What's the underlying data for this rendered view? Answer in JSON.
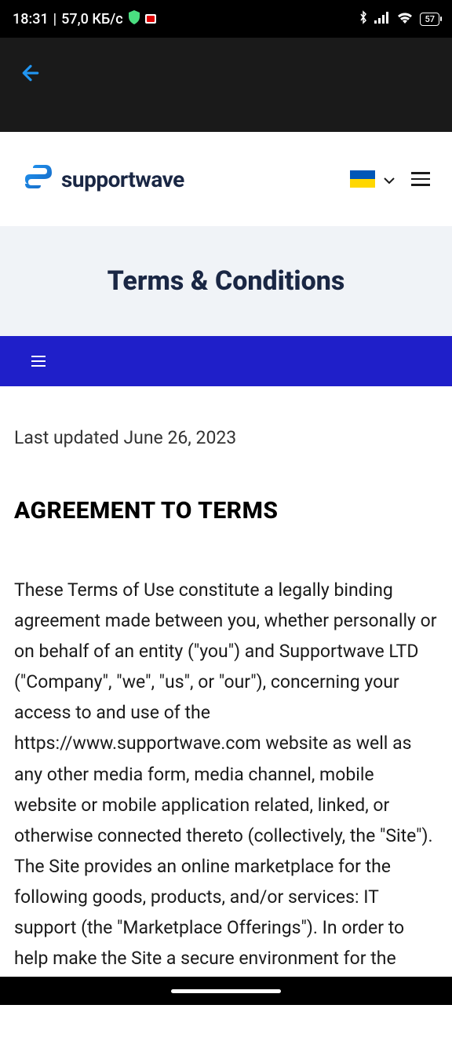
{
  "statusBar": {
    "time": "18:31",
    "dataRate": "57,0 КБ/с",
    "batteryLevel": "57"
  },
  "header": {
    "brandName": "supportwave"
  },
  "page": {
    "title": "Terms & Conditions",
    "lastUpdated": "Last updated June 26, 2023",
    "sectionHeading": "AGREEMENT TO TERMS",
    "bodyText": "These Terms of Use constitute a legally binding agreement made between you, whether personally or on behalf of an entity (\"you\") and Supportwave LTD (\"Company\", \"we\", \"us\", or \"our\"), concerning your access to and use of the https://www.supportwave.com website as well as any other media form, media channel, mobile website or mobile application related, linked, or otherwise connected thereto (collectively, the \"Site\"). The Site provides an online marketplace for the following goods, products, and/or services: IT support (the \"Marketplace Offerings\"). In order to help make the Site a secure environment for the purchase and sale of"
  }
}
